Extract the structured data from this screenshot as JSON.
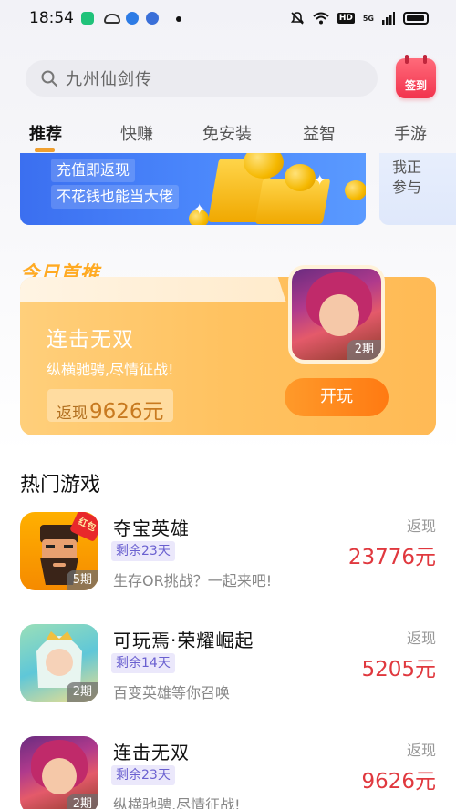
{
  "status_bar": {
    "time": "18:54",
    "hd": "HD",
    "signal": "5G"
  },
  "search": {
    "placeholder": "九州仙剑传"
  },
  "checkin": {
    "label": "签到"
  },
  "tabs": [
    {
      "label": "推荐",
      "active": true
    },
    {
      "label": "快赚",
      "active": false
    },
    {
      "label": "免安装",
      "active": false
    },
    {
      "label": "益智",
      "active": false
    },
    {
      "label": "手游",
      "active": false
    }
  ],
  "promo_banner": {
    "line1": "充值即返现",
    "line2": "不花钱也能当大佬"
  },
  "side_banner": {
    "text": "我正参与"
  },
  "featured": {
    "section_title": "今日首推",
    "name": "连击无双",
    "desc": "纵横驰骋,尽情征战!",
    "cashback_label": "返现",
    "cashback_value": "9626元",
    "period": "2期",
    "play_label": "开玩"
  },
  "hot_games": {
    "section_title": "热门游戏",
    "items": [
      {
        "title": "夺宝英雄",
        "remaining": "剩余23天",
        "desc": "生存OR挑战？一起来吧!",
        "cashback_label": "返现",
        "amount": "23776元",
        "period": "5期",
        "hongbao": "红包"
      },
      {
        "title": "可玩焉·荣耀崛起",
        "remaining": "剩余14天",
        "desc": "百变英雄等你召唤",
        "cashback_label": "返现",
        "amount": "5205元",
        "period": "2期"
      },
      {
        "title": "连击无双",
        "remaining": "剩余23天",
        "desc": "纵横驰骋,尽情征战!",
        "cashback_label": "返现",
        "amount": "9626元",
        "period": "2期"
      }
    ]
  },
  "colors": {
    "accent_orange": "#ff8a1a",
    "cashback_red": "#e0383e",
    "tag_purple": "#6a60d0",
    "banner_blue": "#4a86fb"
  }
}
